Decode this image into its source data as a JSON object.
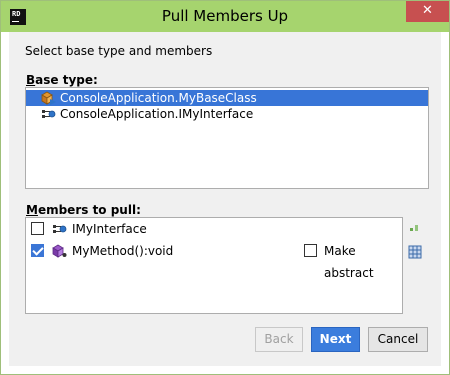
{
  "window": {
    "title": "Pull Members Up",
    "app_icon_text": "RD",
    "close_glyph": "✕",
    "colors": {
      "titlebar": "#a6d46e",
      "close": "#c75050",
      "selection": "#3875d7",
      "primary_button": "#3b7ddd"
    }
  },
  "instruction": "Select base type and members",
  "base_type": {
    "label_mnemonic": "B",
    "label_rest": "ase type:",
    "items": [
      {
        "label": "ConsoleApplication.MyBaseClass",
        "icon": "class-icon",
        "selected": true
      },
      {
        "label": "ConsoleApplication.IMyInterface",
        "icon": "interface-icon",
        "selected": false
      }
    ]
  },
  "members": {
    "label_mnemonic": "M",
    "label_rest": "embers to pull:",
    "items": [
      {
        "label": "IMyInterface",
        "icon": "interface-icon",
        "checked": false
      },
      {
        "label": "MyMethod():void",
        "icon": "method-icon",
        "checked": true,
        "make_abstract_label": "Make abstract",
        "make_abstract_checked": false
      }
    ],
    "side_icons": [
      "dependencies-icon",
      "select-all-icon"
    ]
  },
  "buttons": {
    "back": "Back",
    "next": "Next",
    "cancel": "Cancel"
  }
}
